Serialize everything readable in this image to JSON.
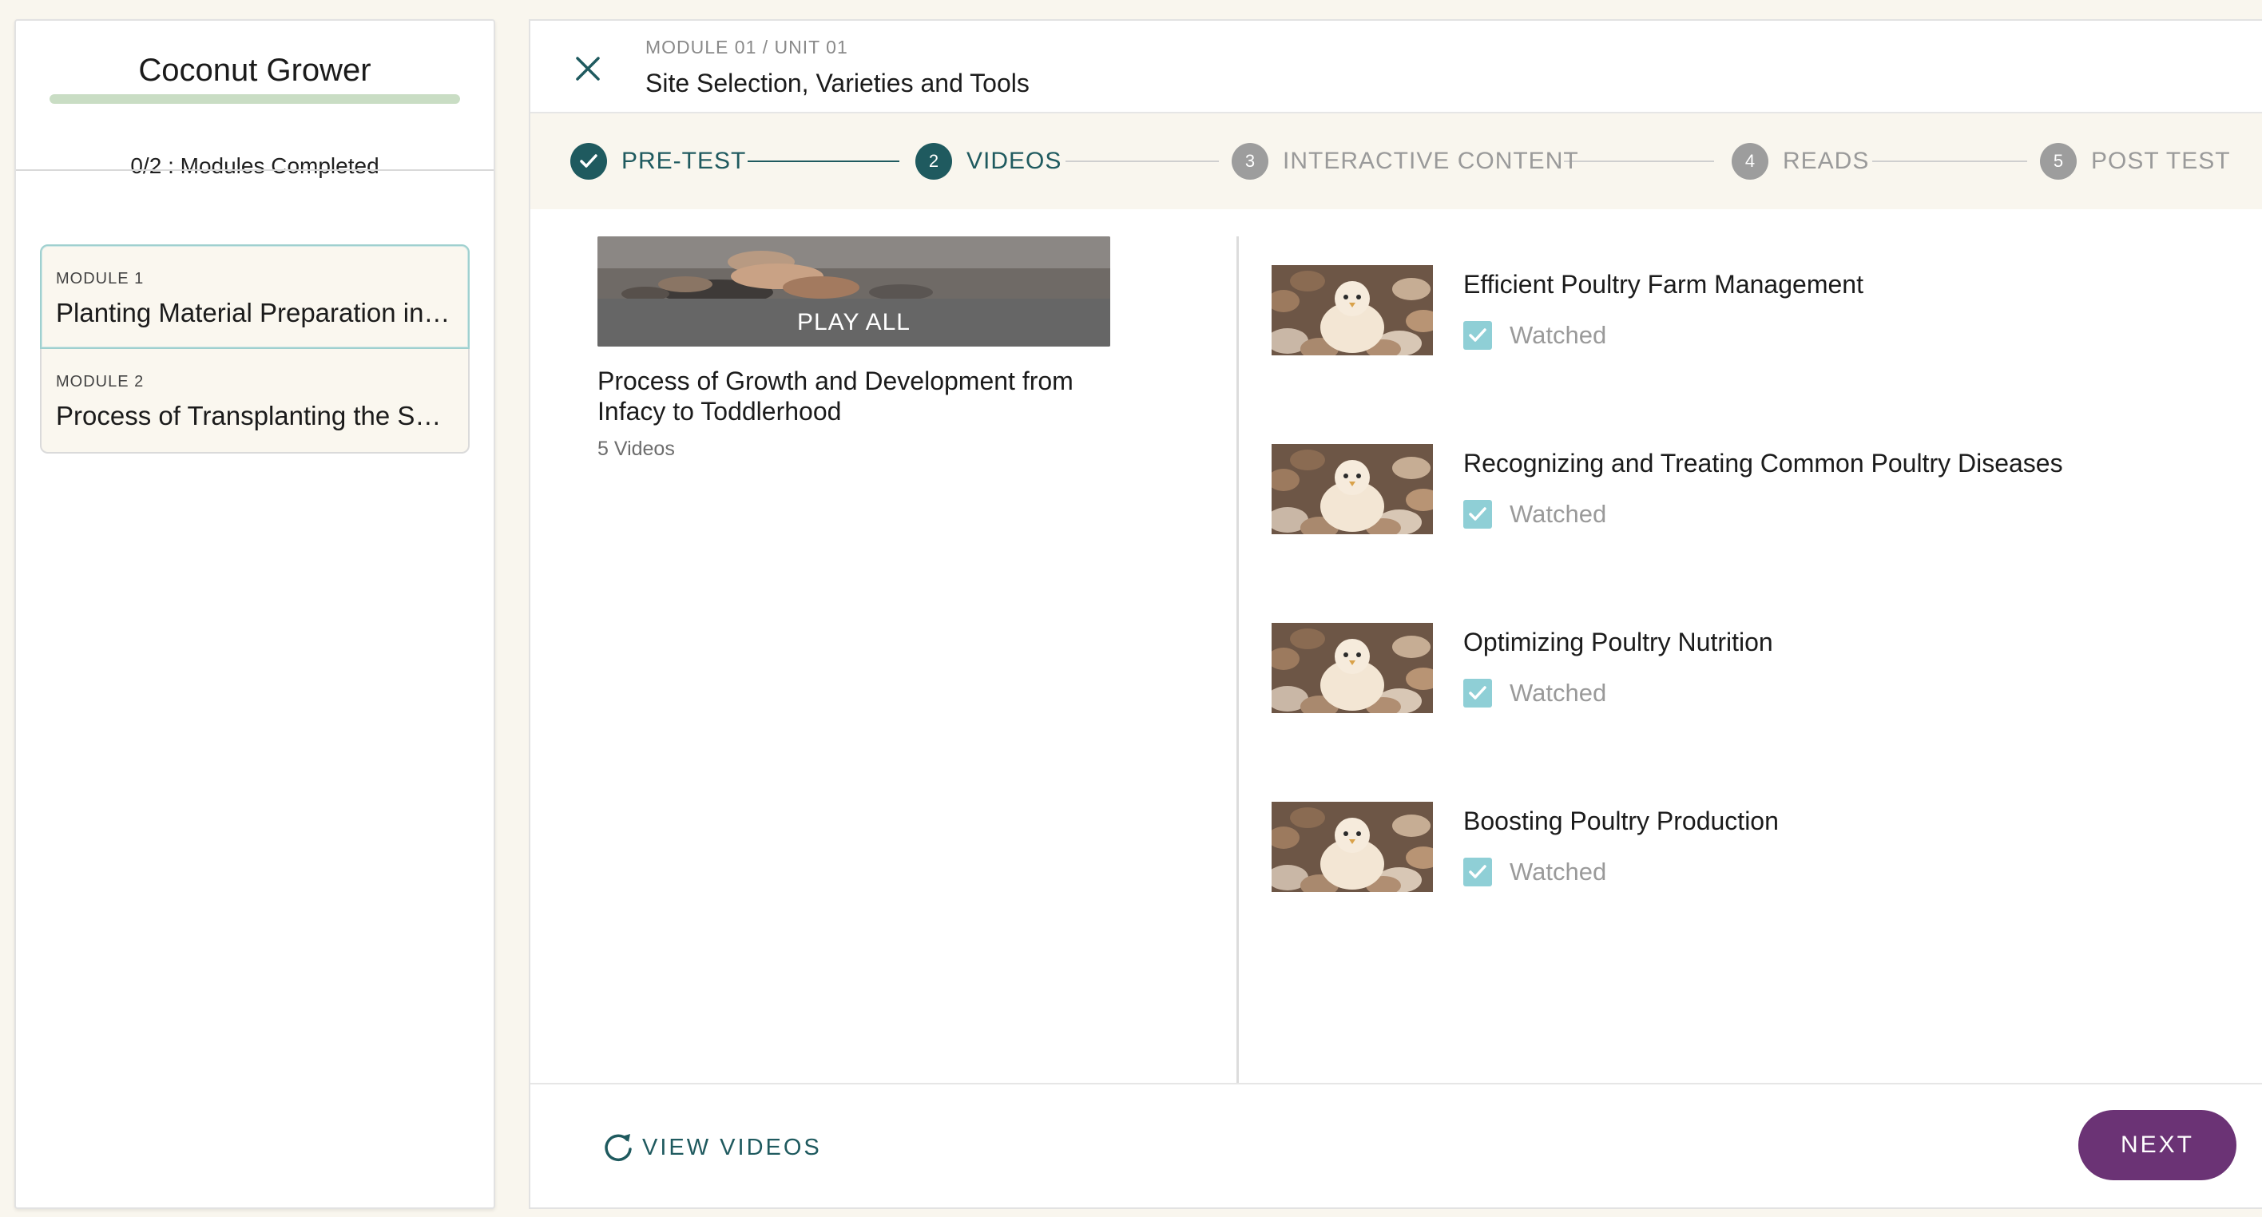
{
  "sidebar": {
    "course_title": "Coconut Grower",
    "progress_text": "0/2 : Modules Completed",
    "modules": [
      {
        "label": "MODULE 1",
        "name": "Planting Material Preparation in Nursery"
      },
      {
        "label": "MODULE 2",
        "name": "Process of Transplanting the Seedlings"
      }
    ]
  },
  "header": {
    "breadcrumb": "MODULE 01 / UNIT 01",
    "title": "Site Selection, Varieties and Tools"
  },
  "stepper": {
    "steps": [
      {
        "number": "1",
        "label": "PRE-TEST",
        "state": "done"
      },
      {
        "number": "2",
        "label": "VIDEOS",
        "state": "active"
      },
      {
        "number": "3",
        "label": "INTERACTIVE CONTENT",
        "state": "pending"
      },
      {
        "number": "4",
        "label": "READS",
        "state": "pending"
      },
      {
        "number": "5",
        "label": "POST TEST",
        "state": "pending"
      }
    ]
  },
  "playlist": {
    "play_all_label": "PLAY ALL",
    "title": "Process of Growth and Development from Infacy to Toddlerhood",
    "count": "5 Videos"
  },
  "videos": [
    {
      "title": "Efficient Poultry Farm Management",
      "status": "Watched"
    },
    {
      "title": "Recognizing and Treating Common Poultry Diseases",
      "status": "Watched"
    },
    {
      "title": "Optimizing Poultry Nutrition",
      "status": "Watched"
    },
    {
      "title": "Boosting Poultry Production",
      "status": "Watched"
    }
  ],
  "footer": {
    "view_videos_label": "VIEW VIDEOS",
    "next_label": "NEXT"
  },
  "colors": {
    "primary": "#1f5a5f",
    "accent": "#6b3375",
    "progress": "#c9ddc4",
    "checkbox": "#8fcfd6"
  }
}
